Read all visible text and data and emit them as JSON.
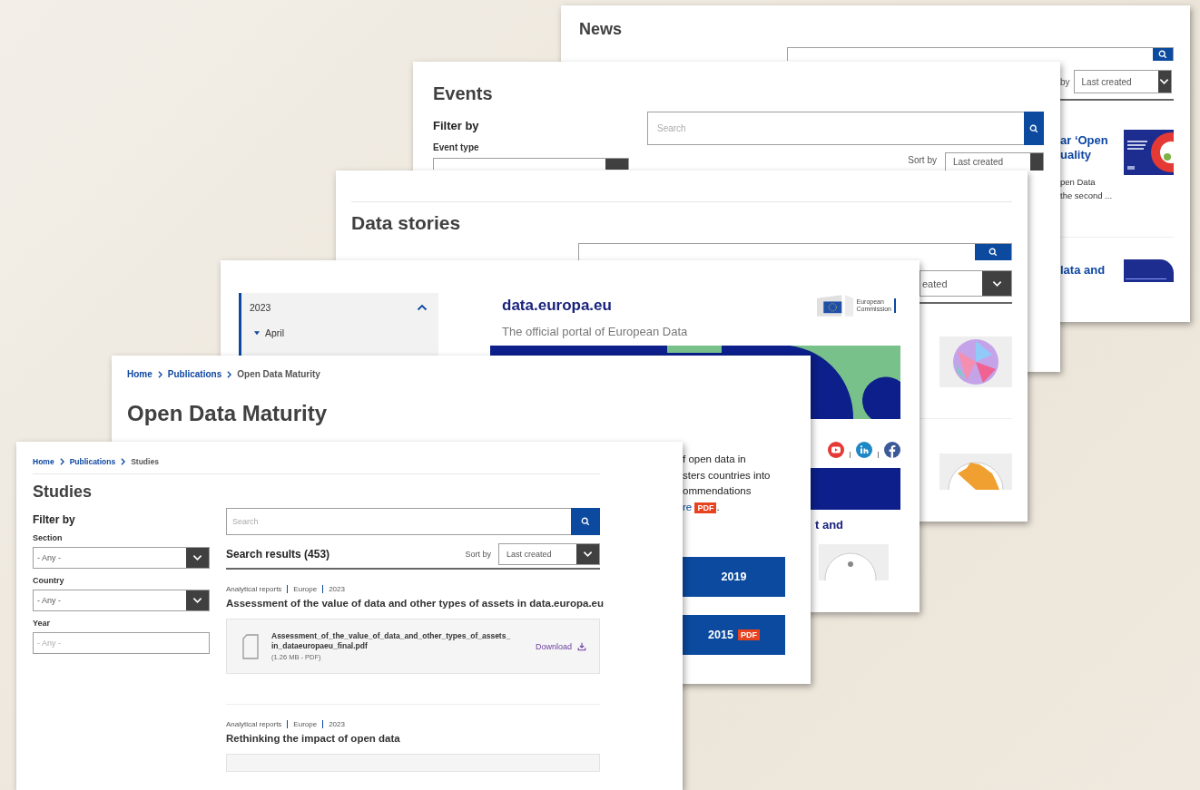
{
  "news_page": {
    "title": "News",
    "sort_label": "by",
    "sort_value": "Last created",
    "articles": [
      {
        "kind": "poster",
        "title_lines": [
          "ar ‘Open",
          "uality"
        ],
        "excerpt_lines": [
          "pen Data",
          "the second ..."
        ]
      },
      {
        "kind": "banner",
        "title_lines": [
          "lata and"
        ]
      }
    ]
  },
  "events_page": {
    "title": "Events",
    "filter_heading": "Filter by",
    "filters": [
      {
        "label": "Event type"
      }
    ],
    "search": {
      "placeholder": "Search"
    },
    "sort_label": "Sort by",
    "sort_value": "Last created"
  },
  "data_stories_page": {
    "title": "Data stories",
    "sort_value": "eated",
    "thumbnails": [
      {
        "kind": "mosaic"
      },
      {
        "kind": "radial"
      }
    ]
  },
  "portal_page": {
    "tree": [
      {
        "label": "2023",
        "expanded": true,
        "children": [
          {
            "label": "April",
            "expanded": true
          }
        ]
      }
    ],
    "site_name": "data.europa.eu",
    "org_name_lines": [
      "European",
      "Commission"
    ],
    "tagline": "The official portal of European Data",
    "teaser": "t and"
  },
  "maturity_page": {
    "breadcrumb": [
      {
        "label": "Home"
      },
      {
        "label": "Publications"
      },
      {
        "label": "Open Data Maturity"
      }
    ],
    "title": "Open Data Maturity",
    "intro_lines": [
      "f open data in",
      "sters countries into",
      "ommendations"
    ],
    "link_fragment": "re",
    "link_badge": "PDF",
    "link_trailer": ".",
    "year_buttons": [
      {
        "label": "2019"
      },
      {
        "label": "2015",
        "badge": "PDF"
      }
    ]
  },
  "studies_page": {
    "breadcrumb": [
      {
        "label": "Home"
      },
      {
        "label": "Publications"
      },
      {
        "label": "Studies"
      }
    ],
    "title": "Studies",
    "filter_heading": "Filter by",
    "filters": [
      {
        "kind": "select",
        "label": "Section",
        "value": "- Any -"
      },
      {
        "kind": "select",
        "label": "Country",
        "value": "- Any -"
      },
      {
        "kind": "input",
        "label": "Year",
        "placeholder": "- Any -"
      }
    ],
    "search": {
      "placeholder": "Search"
    },
    "results_heading": "Search results (453)",
    "sort_label": "Sort by",
    "sort_value": "Last created",
    "results": [
      {
        "tags": [
          "Analytical reports",
          "Europe",
          "2023"
        ],
        "title": "Assessment of the value of data and other types of assets in data.europa.eu",
        "file": {
          "name_lines": [
            "Assessment_of_the_value_of_data_and_other_types_of_assets_",
            "in_dataeuropaeu_final.pdf"
          ],
          "meta": "(1.26 MB - PDF)",
          "action": "Download"
        }
      },
      {
        "tags": [
          "Analytical reports",
          "Europe",
          "2023"
        ],
        "title": "Rethinking the impact of open data"
      }
    ]
  }
}
